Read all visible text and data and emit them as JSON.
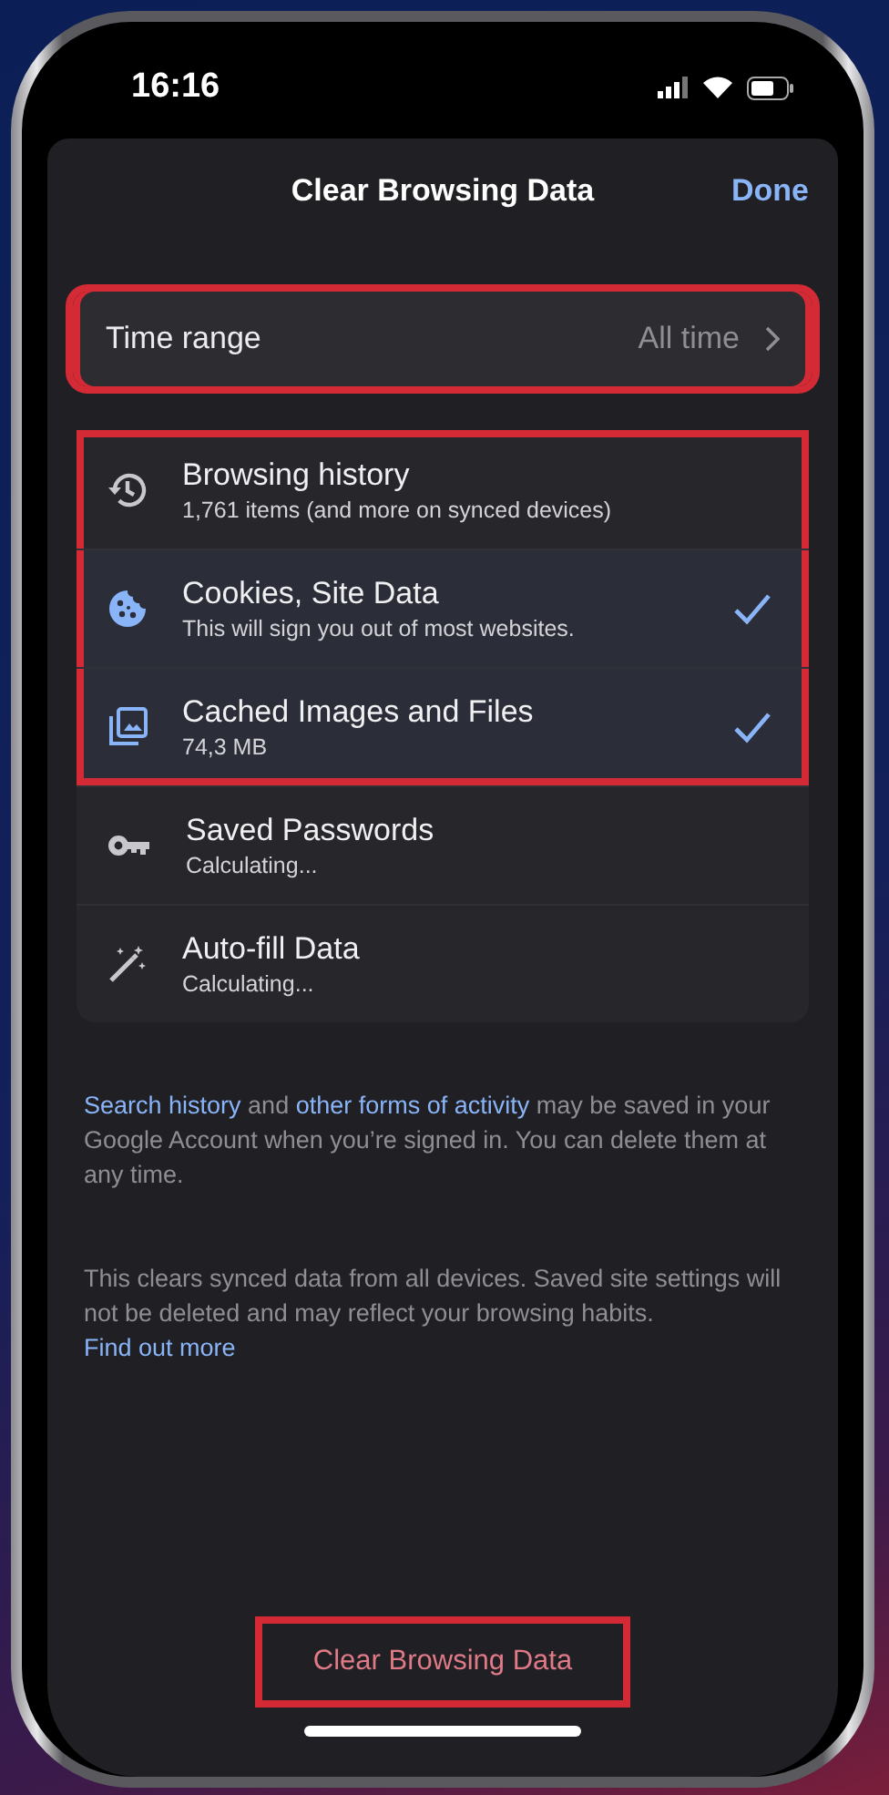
{
  "status_bar": {
    "time": "16:16"
  },
  "header": {
    "title": "Clear Browsing Data",
    "done": "Done"
  },
  "time_range": {
    "label": "Time range",
    "value": "All time",
    "highlighted": true
  },
  "items": [
    {
      "kind": "history",
      "title": "Browsing history",
      "subtitle": "1,761 items (and more on synced devices)",
      "checked": false,
      "highlighted": true
    },
    {
      "kind": "cookies",
      "title": "Cookies, Site Data",
      "subtitle": "This will sign you out of most websites.",
      "checked": true,
      "highlighted": true
    },
    {
      "kind": "cache",
      "title": "Cached Images and Files",
      "subtitle": "74,3 MB",
      "checked": true,
      "highlighted": true
    },
    {
      "kind": "passwords",
      "title": "Saved Passwords",
      "subtitle": "Calculating...",
      "checked": false,
      "highlighted": false
    },
    {
      "kind": "autofill",
      "title": "Auto-fill Data",
      "subtitle": "Calculating...",
      "checked": false,
      "highlighted": false
    }
  ],
  "notes": [
    [
      {
        "kind": "link",
        "text": "Search history"
      },
      {
        "kind": "text",
        "text": " and "
      },
      {
        "kind": "link",
        "text": "other forms of activity"
      },
      {
        "kind": "text",
        "text": " may be saved in your Google Account when you’re signed in. You can delete them at any time."
      }
    ],
    [
      {
        "kind": "text",
        "text": "This clears synced data from all devices. Saved site settings will not be deleted and may reflect your browsing habits. "
      },
      {
        "kind": "link",
        "text": "Find out more"
      }
    ]
  ],
  "clear_button": {
    "label": "Clear Browsing Data",
    "highlighted": true
  }
}
